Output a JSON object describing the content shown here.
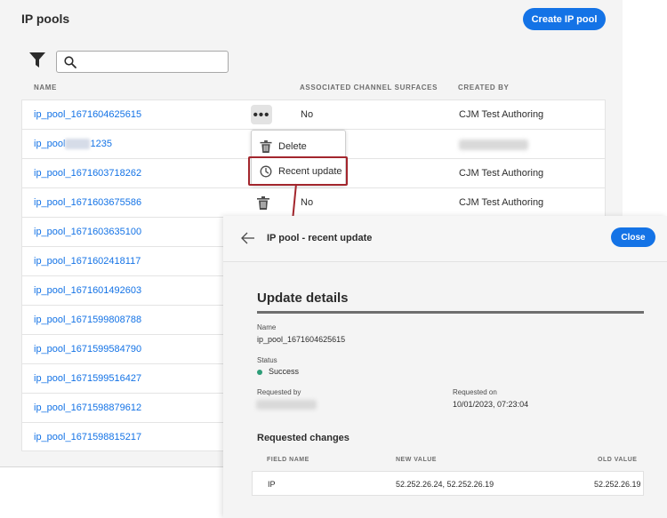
{
  "list": {
    "title": "IP pools",
    "create_button": "Create IP pool",
    "search_placeholder": "",
    "columns": {
      "name": "NAME",
      "channel": "ASSOCIATED CHANNEL SURFACES",
      "creator": "CREATED BY"
    },
    "rows": [
      {
        "name": "ip_pool_1671604625615",
        "channel": "No",
        "creator": "CJM Test Authoring"
      },
      {
        "name_prefix": "ip_pool",
        "name_suffix": "1235",
        "channel": "",
        "creator": ""
      },
      {
        "name": "ip_pool_1671603718262",
        "channel": "",
        "creator": "CJM Test Authoring"
      },
      {
        "name": "ip_pool_1671603675586",
        "channel": "No",
        "creator": "CJM Test Authoring"
      },
      {
        "name": "ip_pool_1671603635100"
      },
      {
        "name": "ip_pool_1671602418117"
      },
      {
        "name": "ip_pool_1671601492603"
      },
      {
        "name": "ip_pool_1671599808788"
      },
      {
        "name": "ip_pool_1671599584790"
      },
      {
        "name": "ip_pool_1671599516427"
      },
      {
        "name": "ip_pool_1671598879612"
      },
      {
        "name": "ip_pool_1671598815217"
      }
    ]
  },
  "menu": {
    "more_label": "•••",
    "delete": "Delete",
    "recent_update": "Recent update"
  },
  "detail": {
    "title": "IP pool - recent update",
    "close": "Close",
    "section": "Update details",
    "name_label": "Name",
    "name_value": "ip_pool_1671604625615",
    "status_label": "Status",
    "status_value": "Success",
    "requested_by_label": "Requested by",
    "requested_on_label": "Requested on",
    "requested_on_value": "10/01/2023, 07:23:04",
    "changes_title": "Requested changes",
    "changes_columns": {
      "field": "FIELD NAME",
      "new": "NEW VALUE",
      "old": "OLD VALUE"
    },
    "changes": [
      {
        "field": "IP",
        "new": "52.252.26.24, 52.252.26.19",
        "old": "52.252.26.19"
      }
    ]
  },
  "colors": {
    "accent": "#1473e6",
    "highlight": "#a3262d",
    "success": "#2d9d78"
  }
}
